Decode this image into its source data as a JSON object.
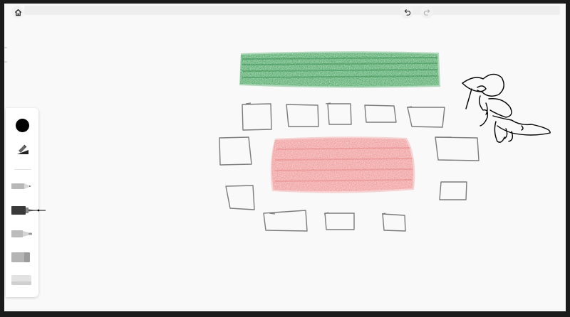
{
  "app": {
    "background": "#f9f9f9",
    "frame_color": "#1b1b1b"
  },
  "toolbar": {
    "home_icon": "home-icon",
    "undo_icon": "undo-icon",
    "redo_icon": "redo-icon"
  },
  "toolbox": {
    "selected_color": "#000000",
    "tools": [
      {
        "name": "color-picker",
        "icon": "color-circle-icon"
      },
      {
        "name": "stroke-width",
        "icon": "stroke-width-icon"
      },
      {
        "name": "pencil",
        "icon": "pencil-icon"
      },
      {
        "name": "fountain-pen",
        "icon": "fountain-pen-icon",
        "selected": true
      },
      {
        "name": "marker",
        "icon": "marker-icon"
      },
      {
        "name": "highlighter",
        "icon": "highlighter-icon"
      },
      {
        "name": "eraser",
        "icon": "eraser-icon"
      }
    ]
  },
  "drawing": {
    "green_fill": "#2e9a4a",
    "red_fill": "#f08a8a",
    "pencil_color": "#7c7c7c",
    "ink_color": "#000000"
  }
}
